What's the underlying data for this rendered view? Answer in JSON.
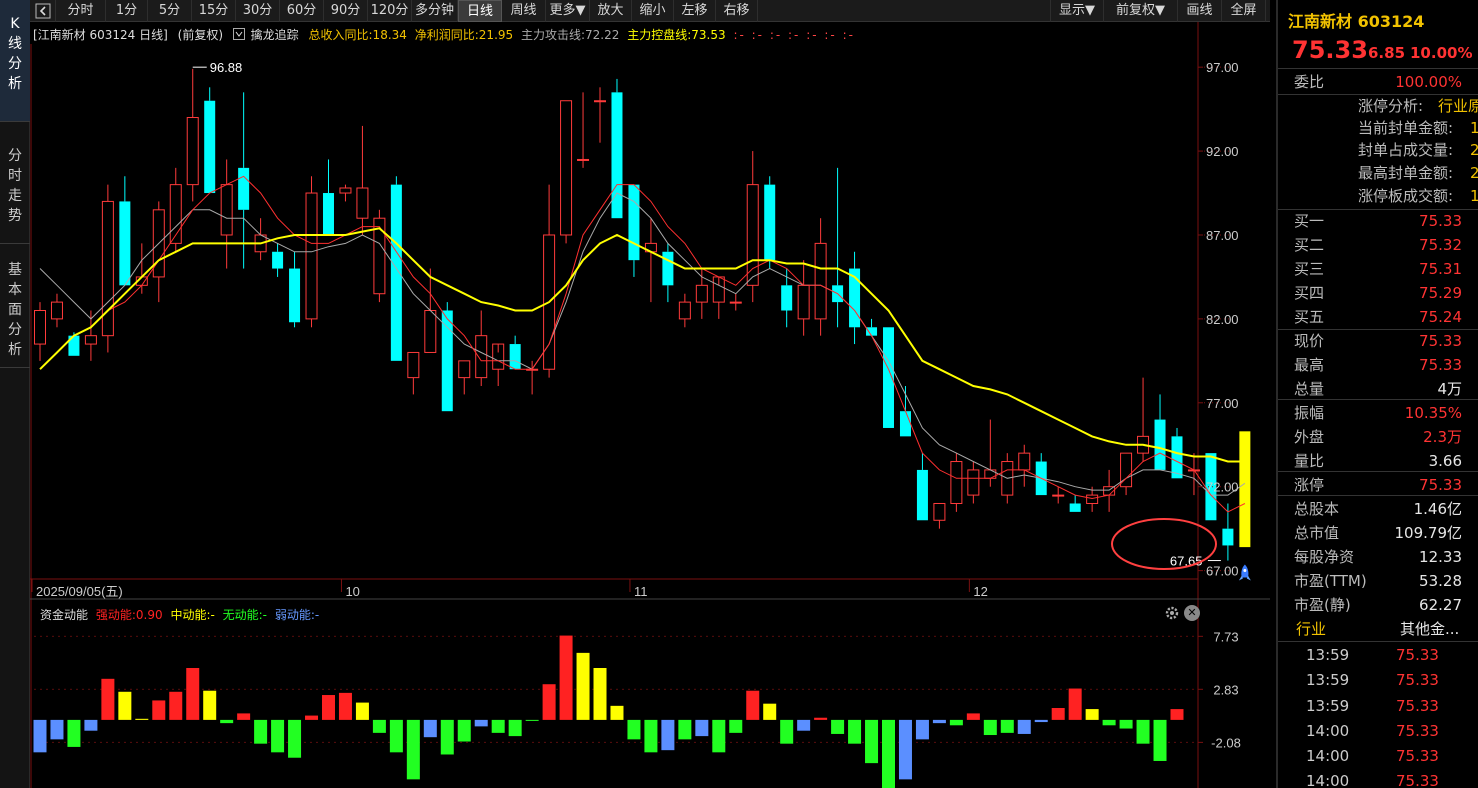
{
  "nav": {
    "left_tabs": [
      "K线分析",
      "分时走势",
      "基本面分析"
    ]
  },
  "toolbar": {
    "items": [
      "分时",
      "1分",
      "5分",
      "15分",
      "30分",
      "60分",
      "90分",
      "120分",
      "多分钟",
      "日线",
      "周线",
      "更多▼",
      "放大",
      "缩小",
      "左移",
      "右移"
    ],
    "right_items": [
      "显示▼",
      "前复权▼",
      "画线",
      "全屏"
    ],
    "active": "日线"
  },
  "info": {
    "title": "[江南新材 603124 日线]",
    "adjust": "(前复权)",
    "indicator_name": "擒龙追踪",
    "revenue": "总收入同比:18.34",
    "profit": "净利润同比:21.95",
    "attack": "主力攻击线:72.22",
    "control": "主力控盘线:73.53",
    "more": ":- :- :- :- :- :- :-"
  },
  "colors": {
    "up": "#ff3b3b",
    "down": "#00ffff",
    "ma_yellow": "#ffff00",
    "ma_white": "#aaaaaa",
    "ma_red": "#ff3030",
    "grid": "#7a1010",
    "axis_text": "#cccccc",
    "accent": "#f2c200"
  },
  "chart_data": [
    {
      "type": "candlestick",
      "title": "江南新材 603124 日线",
      "ylim": [
        66.5,
        98.5
      ],
      "y_ticks": [
        97.0,
        92.0,
        87.0,
        82.0,
        77.0,
        72.0,
        67.0
      ],
      "x_labels": [
        {
          "index": 0,
          "text": "2025/09/05(五)"
        },
        {
          "index": 18,
          "text": "10"
        },
        {
          "index": 35,
          "text": "11"
        },
        {
          "index": 55,
          "text": "12"
        }
      ],
      "annotations": {
        "high": "96.88",
        "low": "67.65"
      },
      "ohlc": [
        [
          80.5,
          83.0,
          79.5,
          82.5
        ],
        [
          82.0,
          83.5,
          81.5,
          83.0
        ],
        [
          81.0,
          81.2,
          79.8,
          79.8
        ],
        [
          80.5,
          82.5,
          79.5,
          81.0
        ],
        [
          81.0,
          90.0,
          80.0,
          89.0
        ],
        [
          89.0,
          90.5,
          84.0,
          84.0
        ],
        [
          84.0,
          86.5,
          83.5,
          84.5
        ],
        [
          84.5,
          89.0,
          83.0,
          88.5
        ],
        [
          86.5,
          91.0,
          86.0,
          90.0
        ],
        [
          90.0,
          96.9,
          89.0,
          94.0
        ],
        [
          95.0,
          95.8,
          89.5,
          89.5
        ],
        [
          87.0,
          91.5,
          85.0,
          90.0
        ],
        [
          91.0,
          95.5,
          85.0,
          88.5
        ],
        [
          86.0,
          88.0,
          85.5,
          87.0
        ],
        [
          86.0,
          86.5,
          84.5,
          85.0
        ],
        [
          85.0,
          86.0,
          81.5,
          81.8
        ],
        [
          82.0,
          90.5,
          81.5,
          89.5
        ],
        [
          89.5,
          91.5,
          87.0,
          87.0
        ],
        [
          89.5,
          90.0,
          89.0,
          89.8
        ],
        [
          88.0,
          93.5,
          87.0,
          89.8
        ],
        [
          83.5,
          88.5,
          83.0,
          88.0
        ],
        [
          90.0,
          90.5,
          79.5,
          79.5
        ],
        [
          78.5,
          80.0,
          77.5,
          80.0
        ],
        [
          80.0,
          85.0,
          80.0,
          82.5
        ],
        [
          82.5,
          83.0,
          76.5,
          76.5
        ],
        [
          78.5,
          79.5,
          77.5,
          79.5
        ],
        [
          78.5,
          82.5,
          78.0,
          81.0
        ],
        [
          79.0,
          80.0,
          78.0,
          80.5
        ],
        [
          80.5,
          81.0,
          79.0,
          79.0
        ],
        [
          79.0,
          79.5,
          77.5,
          79.0
        ],
        [
          79.0,
          90.0,
          78.5,
          87.0
        ],
        [
          87.0,
          95.0,
          86.5,
          95.0
        ],
        [
          91.5,
          95.5,
          91.0,
          91.5
        ],
        [
          95.0,
          95.8,
          92.5,
          95.0
        ],
        [
          95.5,
          96.3,
          88.0,
          88.0
        ],
        [
          90.0,
          90.0,
          84.5,
          85.5
        ],
        [
          86.0,
          88.0,
          83.0,
          86.5
        ],
        [
          86.0,
          86.5,
          83.0,
          84.0
        ],
        [
          82.0,
          83.5,
          81.5,
          83.0
        ],
        [
          83.0,
          85.0,
          82.0,
          84.0
        ],
        [
          83.0,
          84.0,
          82.0,
          84.5
        ],
        [
          83.0,
          83.5,
          82.5,
          83.0
        ],
        [
          84.0,
          92.0,
          83.0,
          90.0
        ],
        [
          90.0,
          90.5,
          85.0,
          85.5
        ],
        [
          84.0,
          85.0,
          81.5,
          82.5
        ],
        [
          82.0,
          85.5,
          81.0,
          84.0
        ],
        [
          82.0,
          88.0,
          81.0,
          86.5
        ],
        [
          84.0,
          91.0,
          81.5,
          83.0
        ],
        [
          85.0,
          86.0,
          80.5,
          81.5
        ],
        [
          81.5,
          82.0,
          81.0,
          81.0
        ],
        [
          81.5,
          81.5,
          75.5,
          75.5
        ],
        [
          76.5,
          78.0,
          75.0,
          75.0
        ],
        [
          73.0,
          74.0,
          70.0,
          70.0
        ],
        [
          70.0,
          71.0,
          69.5,
          71.0
        ],
        [
          71.0,
          74.0,
          70.5,
          73.5
        ],
        [
          71.5,
          73.5,
          71.0,
          73.0
        ],
        [
          72.5,
          76.0,
          72.0,
          73.0
        ],
        [
          71.5,
          74.0,
          71.0,
          73.5
        ],
        [
          73.0,
          74.5,
          72.0,
          74.0
        ],
        [
          73.5,
          74.0,
          71.5,
          71.5
        ],
        [
          71.5,
          72.0,
          71.0,
          71.5
        ],
        [
          71.0,
          71.5,
          70.5,
          70.5
        ],
        [
          71.0,
          72.0,
          70.5,
          71.5
        ],
        [
          71.5,
          73.0,
          70.5,
          72.0
        ],
        [
          72.0,
          74.0,
          71.5,
          74.0
        ],
        [
          74.0,
          78.5,
          73.5,
          75.0
        ],
        [
          76.0,
          77.5,
          74.5,
          73.0
        ],
        [
          75.0,
          75.5,
          72.5,
          72.5
        ],
        [
          73.0,
          74.0,
          71.5,
          73.0
        ],
        [
          74.0,
          74.0,
          70.0,
          70.0
        ],
        [
          69.5,
          71.0,
          67.6,
          68.5
        ],
        [
          68.4,
          75.3,
          68.4,
          75.3
        ]
      ],
      "ma_yellow": [
        79.0,
        80.0,
        81.0,
        81.5,
        82.5,
        83.5,
        84.5,
        85.5,
        86.0,
        86.5,
        86.5,
        86.5,
        86.5,
        86.5,
        86.8,
        87.0,
        87.0,
        87.0,
        87.0,
        87.2,
        87.4,
        86.5,
        85.5,
        84.5,
        84.0,
        83.5,
        83.0,
        82.8,
        82.5,
        82.5,
        83.0,
        84.0,
        85.5,
        86.5,
        87.0,
        86.5,
        86.0,
        85.5,
        85.0,
        85.0,
        85.0,
        85.0,
        85.5,
        85.5,
        85.3,
        85.3,
        85.0,
        85.0,
        84.5,
        83.5,
        82.5,
        81.0,
        79.5,
        79.0,
        78.5,
        78.0,
        77.8,
        77.5,
        77.0,
        76.5,
        76.0,
        75.5,
        75.0,
        74.7,
        74.5,
        74.5,
        74.3,
        74.0,
        73.8,
        73.8,
        73.5,
        73.5
      ],
      "ma_white": [
        85.0,
        84.0,
        83.0,
        82.0,
        83.0,
        84.0,
        85.5,
        86.5,
        87.5,
        88.5,
        88.5,
        88.0,
        88.0,
        87.0,
        86.5,
        86.0,
        86.0,
        86.3,
        86.5,
        87.0,
        86.5,
        85.0,
        83.5,
        82.5,
        81.5,
        80.5,
        80.0,
        79.5,
        79.5,
        79.0,
        80.5,
        83.0,
        86.0,
        88.0,
        89.5,
        89.0,
        88.0,
        86.5,
        85.5,
        84.5,
        84.0,
        83.5,
        84.5,
        85.0,
        84.5,
        84.0,
        84.0,
        83.5,
        82.5,
        81.0,
        79.5,
        77.5,
        75.5,
        74.5,
        74.0,
        73.5,
        73.0,
        72.5,
        72.7,
        72.5,
        72.3,
        72.0,
        71.8,
        71.8,
        72.5,
        73.0,
        73.0,
        72.8,
        72.5,
        71.5,
        71.5,
        72.2
      ],
      "ma_red": [
        null,
        null,
        null,
        null,
        82.5,
        83.0,
        84.0,
        85.5,
        87.0,
        88.5,
        89.5,
        90.0,
        90.5,
        89.5,
        88.0,
        87.0,
        86.5,
        86.5,
        87.0,
        87.5,
        87.5,
        86.0,
        84.5,
        83.5,
        82.0,
        81.0,
        79.5,
        79.5,
        79.0,
        79.0,
        80.5,
        83.5,
        87.0,
        88.5,
        90.0,
        90.0,
        89.0,
        87.5,
        86.5,
        85.0,
        84.5,
        84.0,
        85.0,
        85.5,
        85.0,
        84.0,
        84.0,
        83.5,
        82.5,
        81.0,
        79.0,
        76.5,
        74.0,
        73.0,
        72.5,
        72.5,
        72.5,
        73.0,
        73.0,
        72.5,
        72.0,
        71.5,
        71.3,
        71.5,
        72.5,
        73.5,
        74.0,
        73.5,
        73.0,
        71.5,
        70.5,
        71.0
      ]
    },
    {
      "type": "bar",
      "title": "资金动能",
      "legend": [
        {
          "name": "强动能:0.90",
          "color": "#ff2222"
        },
        {
          "name": "中动能:-",
          "color": "#ffff00"
        },
        {
          "name": "无动能:-",
          "color": "#22ff22"
        },
        {
          "name": "弱动能:-",
          "color": "#6699ff"
        }
      ],
      "ylim": [
        -6.3,
        8.5
      ],
      "y_ticks": [
        7.73,
        2.83,
        -2.08
      ],
      "values": [
        [
          -3.0,
          "b"
        ],
        [
          -1.8,
          "b"
        ],
        [
          -2.5,
          "g"
        ],
        [
          -1.0,
          "b"
        ],
        [
          3.8,
          "r"
        ],
        [
          2.6,
          "y"
        ],
        [
          0.1,
          "y"
        ],
        [
          1.8,
          "r"
        ],
        [
          2.6,
          "r"
        ],
        [
          4.8,
          "r"
        ],
        [
          2.7,
          "y"
        ],
        [
          -0.3,
          "g"
        ],
        [
          0.6,
          "r"
        ],
        [
          -2.2,
          "g"
        ],
        [
          -3.0,
          "g"
        ],
        [
          -3.5,
          "g"
        ],
        [
          0.4,
          "r"
        ],
        [
          2.3,
          "r"
        ],
        [
          2.5,
          "r"
        ],
        [
          1.6,
          "y"
        ],
        [
          -1.2,
          "g"
        ],
        [
          -3.0,
          "g"
        ],
        [
          -5.5,
          "g"
        ],
        [
          -1.6,
          "b"
        ],
        [
          -3.2,
          "g"
        ],
        [
          -2.0,
          "g"
        ],
        [
          -0.6,
          "b"
        ],
        [
          -1.2,
          "g"
        ],
        [
          -1.5,
          "g"
        ],
        [
          0.0,
          "g"
        ],
        [
          3.3,
          "r"
        ],
        [
          7.8,
          "r"
        ],
        [
          6.2,
          "y"
        ],
        [
          4.8,
          "y"
        ],
        [
          1.3,
          "y"
        ],
        [
          -1.8,
          "g"
        ],
        [
          -3.0,
          "g"
        ],
        [
          -2.8,
          "b"
        ],
        [
          -1.8,
          "g"
        ],
        [
          -1.5,
          "b"
        ],
        [
          -3.0,
          "g"
        ],
        [
          -1.2,
          "g"
        ],
        [
          2.7,
          "r"
        ],
        [
          1.5,
          "y"
        ],
        [
          -2.2,
          "g"
        ],
        [
          -1.0,
          "b"
        ],
        [
          0.2,
          "r"
        ],
        [
          -1.3,
          "g"
        ],
        [
          -2.2,
          "g"
        ],
        [
          -4.0,
          "g"
        ],
        [
          -6.5,
          "g"
        ],
        [
          -5.5,
          "b"
        ],
        [
          -1.8,
          "b"
        ],
        [
          -0.3,
          "b"
        ],
        [
          -0.5,
          "g"
        ],
        [
          0.6,
          "r"
        ],
        [
          -1.4,
          "g"
        ],
        [
          -1.2,
          "g"
        ],
        [
          -1.3,
          "b"
        ],
        [
          -0.2,
          "b"
        ],
        [
          1.1,
          "r"
        ],
        [
          2.9,
          "r"
        ],
        [
          1.0,
          "y"
        ],
        [
          -0.5,
          "g"
        ],
        [
          -0.8,
          "g"
        ],
        [
          -2.2,
          "g"
        ],
        [
          -3.8,
          "g"
        ],
        [
          1.0,
          "r"
        ]
      ]
    }
  ],
  "sub_indicator": {
    "name": "资金动能",
    "strong": "强动能:0.90",
    "medium": "中动能:-",
    "none": "无动能:-",
    "weak": "弱动能:-",
    "gear_icon": "gear-icon",
    "close_icon": "close-icon"
  },
  "quote": {
    "name": "江南新材 603124",
    "price": "75.33",
    "change": "6.85",
    "change_pct": "10.00%",
    "webi_label": "委比",
    "webi_value": "100.00%",
    "limit": [
      {
        "label": "涨停分析:",
        "value": "行业原"
      },
      {
        "label": "当前封单金额:",
        "value": "1"
      },
      {
        "label": "封单占成交量:",
        "value": "2"
      },
      {
        "label": "最高封单金额:",
        "value": "2"
      },
      {
        "label": "涨停板成交额:",
        "value": "1"
      }
    ],
    "bids": [
      {
        "label": "买一",
        "value": "75.33"
      },
      {
        "label": "买二",
        "value": "75.32"
      },
      {
        "label": "买三",
        "value": "75.31"
      },
      {
        "label": "买四",
        "value": "75.29"
      },
      {
        "label": "买五",
        "value": "75.24"
      }
    ],
    "stats": [
      {
        "label": "现价",
        "value": "75.33",
        "red": true
      },
      {
        "label": "最高",
        "value": "75.33",
        "red": true
      },
      {
        "label": "总量",
        "value": "4万",
        "red": false
      },
      {
        "label": "振幅",
        "value": "10.35%",
        "red": true
      },
      {
        "label": "外盘",
        "value": "2.3万",
        "red": true
      },
      {
        "label": "量比",
        "value": "3.66",
        "red": false
      },
      {
        "label": "涨停",
        "value": "75.33",
        "red": true
      },
      {
        "label": "总股本",
        "value": "1.46亿",
        "red": false
      },
      {
        "label": "总市值",
        "value": "109.79亿",
        "red": false
      },
      {
        "label": "每股净资",
        "value": "12.33",
        "red": false
      },
      {
        "label": "市盈(TTM)",
        "value": "53.28",
        "red": false
      },
      {
        "label": "市盈(静)",
        "value": "62.27",
        "red": false
      }
    ],
    "industry_label": "行业",
    "industry_value": "其他金...",
    "ticks": [
      {
        "time": "13:59",
        "price": "75.33"
      },
      {
        "time": "13:59",
        "price": "75.33"
      },
      {
        "time": "13:59",
        "price": "75.33"
      },
      {
        "time": "14:00",
        "price": "75.33"
      },
      {
        "time": "14:00",
        "price": "75.33"
      },
      {
        "time": "14:00",
        "price": "75.33"
      }
    ]
  }
}
